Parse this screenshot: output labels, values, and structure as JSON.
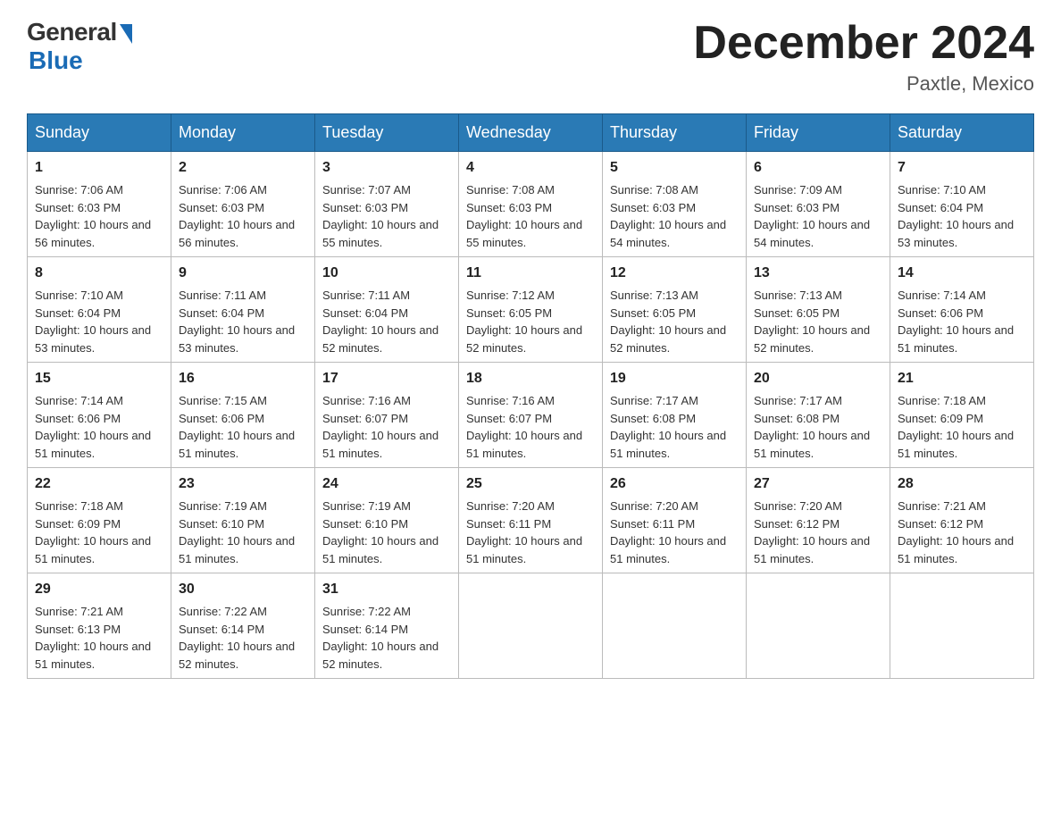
{
  "logo": {
    "general": "General",
    "blue": "Blue",
    "tagline": "Blue"
  },
  "header": {
    "title": "December 2024",
    "location": "Paxtle, Mexico"
  },
  "days_of_week": [
    "Sunday",
    "Monday",
    "Tuesday",
    "Wednesday",
    "Thursday",
    "Friday",
    "Saturday"
  ],
  "weeks": [
    [
      {
        "day": "1",
        "sunrise": "7:06 AM",
        "sunset": "6:03 PM",
        "daylight": "10 hours and 56 minutes."
      },
      {
        "day": "2",
        "sunrise": "7:06 AM",
        "sunset": "6:03 PM",
        "daylight": "10 hours and 56 minutes."
      },
      {
        "day": "3",
        "sunrise": "7:07 AM",
        "sunset": "6:03 PM",
        "daylight": "10 hours and 55 minutes."
      },
      {
        "day": "4",
        "sunrise": "7:08 AM",
        "sunset": "6:03 PM",
        "daylight": "10 hours and 55 minutes."
      },
      {
        "day": "5",
        "sunrise": "7:08 AM",
        "sunset": "6:03 PM",
        "daylight": "10 hours and 54 minutes."
      },
      {
        "day": "6",
        "sunrise": "7:09 AM",
        "sunset": "6:03 PM",
        "daylight": "10 hours and 54 minutes."
      },
      {
        "day": "7",
        "sunrise": "7:10 AM",
        "sunset": "6:04 PM",
        "daylight": "10 hours and 53 minutes."
      }
    ],
    [
      {
        "day": "8",
        "sunrise": "7:10 AM",
        "sunset": "6:04 PM",
        "daylight": "10 hours and 53 minutes."
      },
      {
        "day": "9",
        "sunrise": "7:11 AM",
        "sunset": "6:04 PM",
        "daylight": "10 hours and 53 minutes."
      },
      {
        "day": "10",
        "sunrise": "7:11 AM",
        "sunset": "6:04 PM",
        "daylight": "10 hours and 52 minutes."
      },
      {
        "day": "11",
        "sunrise": "7:12 AM",
        "sunset": "6:05 PM",
        "daylight": "10 hours and 52 minutes."
      },
      {
        "day": "12",
        "sunrise": "7:13 AM",
        "sunset": "6:05 PM",
        "daylight": "10 hours and 52 minutes."
      },
      {
        "day": "13",
        "sunrise": "7:13 AM",
        "sunset": "6:05 PM",
        "daylight": "10 hours and 52 minutes."
      },
      {
        "day": "14",
        "sunrise": "7:14 AM",
        "sunset": "6:06 PM",
        "daylight": "10 hours and 51 minutes."
      }
    ],
    [
      {
        "day": "15",
        "sunrise": "7:14 AM",
        "sunset": "6:06 PM",
        "daylight": "10 hours and 51 minutes."
      },
      {
        "day": "16",
        "sunrise": "7:15 AM",
        "sunset": "6:06 PM",
        "daylight": "10 hours and 51 minutes."
      },
      {
        "day": "17",
        "sunrise": "7:16 AM",
        "sunset": "6:07 PM",
        "daylight": "10 hours and 51 minutes."
      },
      {
        "day": "18",
        "sunrise": "7:16 AM",
        "sunset": "6:07 PM",
        "daylight": "10 hours and 51 minutes."
      },
      {
        "day": "19",
        "sunrise": "7:17 AM",
        "sunset": "6:08 PM",
        "daylight": "10 hours and 51 minutes."
      },
      {
        "day": "20",
        "sunrise": "7:17 AM",
        "sunset": "6:08 PM",
        "daylight": "10 hours and 51 minutes."
      },
      {
        "day": "21",
        "sunrise": "7:18 AM",
        "sunset": "6:09 PM",
        "daylight": "10 hours and 51 minutes."
      }
    ],
    [
      {
        "day": "22",
        "sunrise": "7:18 AM",
        "sunset": "6:09 PM",
        "daylight": "10 hours and 51 minutes."
      },
      {
        "day": "23",
        "sunrise": "7:19 AM",
        "sunset": "6:10 PM",
        "daylight": "10 hours and 51 minutes."
      },
      {
        "day": "24",
        "sunrise": "7:19 AM",
        "sunset": "6:10 PM",
        "daylight": "10 hours and 51 minutes."
      },
      {
        "day": "25",
        "sunrise": "7:20 AM",
        "sunset": "6:11 PM",
        "daylight": "10 hours and 51 minutes."
      },
      {
        "day": "26",
        "sunrise": "7:20 AM",
        "sunset": "6:11 PM",
        "daylight": "10 hours and 51 minutes."
      },
      {
        "day": "27",
        "sunrise": "7:20 AM",
        "sunset": "6:12 PM",
        "daylight": "10 hours and 51 minutes."
      },
      {
        "day": "28",
        "sunrise": "7:21 AM",
        "sunset": "6:12 PM",
        "daylight": "10 hours and 51 minutes."
      }
    ],
    [
      {
        "day": "29",
        "sunrise": "7:21 AM",
        "sunset": "6:13 PM",
        "daylight": "10 hours and 51 minutes."
      },
      {
        "day": "30",
        "sunrise": "7:22 AM",
        "sunset": "6:14 PM",
        "daylight": "10 hours and 52 minutes."
      },
      {
        "day": "31",
        "sunrise": "7:22 AM",
        "sunset": "6:14 PM",
        "daylight": "10 hours and 52 minutes."
      },
      null,
      null,
      null,
      null
    ]
  ]
}
